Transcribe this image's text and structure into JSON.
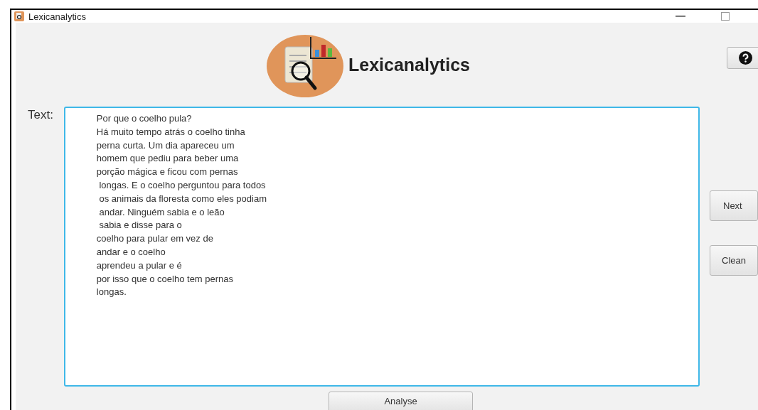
{
  "window": {
    "title": "Lexicanalytics"
  },
  "header": {
    "app_name": "Lexicanalytics"
  },
  "text_field": {
    "label": "Text:",
    "lines": [
      "Por que o coelho pula?",
      "Há muito tempo atrás o coelho tinha",
      "perna curta. Um dia apareceu um",
      "homem que pediu para beber uma",
      "porção mágica e ficou com pernas",
      " longas. E o coelho perguntou para todos",
      " os animais da floresta como eles podiam",
      " andar. Ninguém sabia e o leão",
      " sabia e disse para o",
      "coelho para pular em vez de",
      "andar e o coelho",
      "aprendeu a pular e é",
      "por isso que o coelho tem pernas",
      "longas."
    ]
  },
  "side_buttons": [
    "Next",
    "Clean"
  ],
  "analyse_button": "Analyse"
}
